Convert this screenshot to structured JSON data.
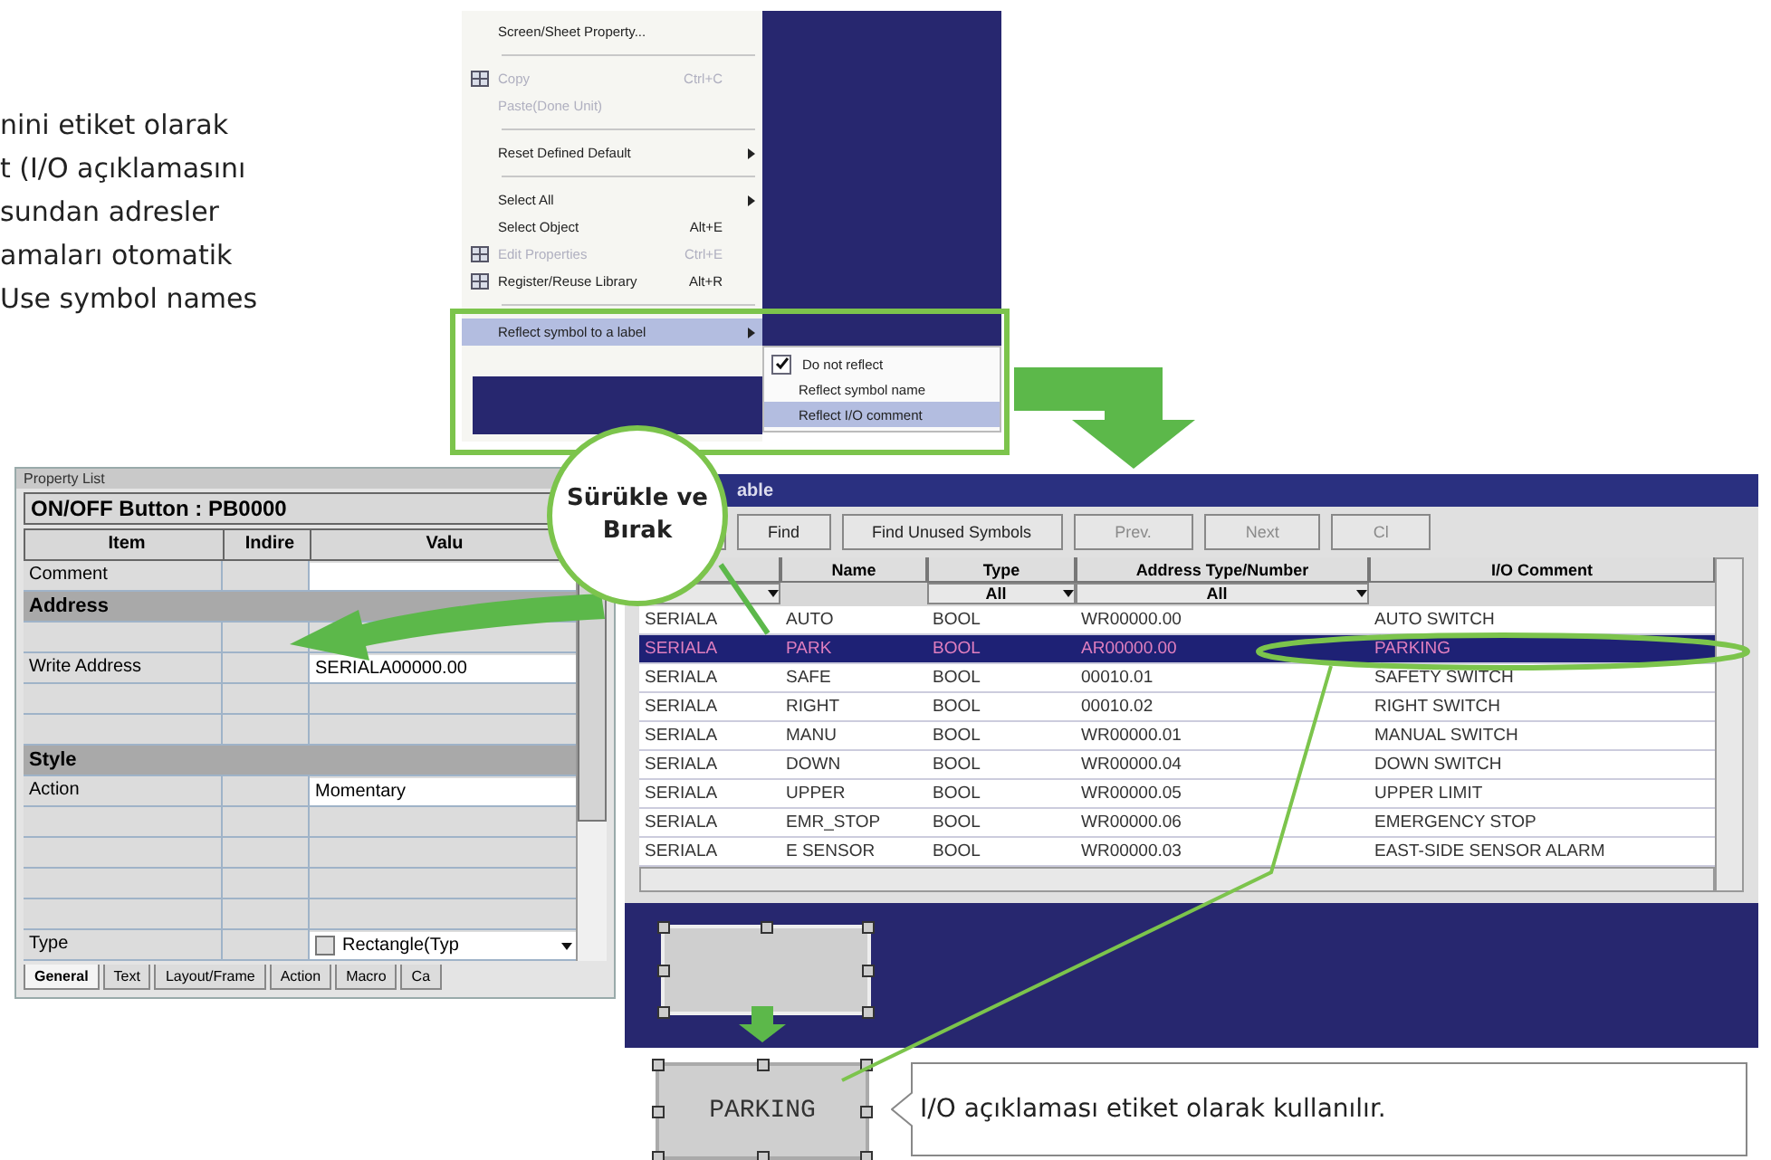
{
  "intro_text": {
    "lines": [
      "nini etiket olarak",
      "t (I/O açıklamasını",
      "sundan adresler",
      "amaları otomatik",
      "Use symbol names"
    ]
  },
  "context_menu": {
    "items": [
      {
        "kind": "item",
        "label": "Screen/Sheet Property...",
        "disabled": false,
        "selected": false,
        "has_submenu": false,
        "has_icon": false
      },
      {
        "kind": "separator"
      },
      {
        "kind": "item",
        "label": "Copy",
        "shortcut": "Ctrl+C",
        "disabled": true,
        "selected": false,
        "has_submenu": false,
        "has_icon": true
      },
      {
        "kind": "item",
        "label": "Paste(Done Unit)",
        "disabled": true,
        "selected": false,
        "has_submenu": false,
        "has_icon": false
      },
      {
        "kind": "separator"
      },
      {
        "kind": "item",
        "label": "Reset Defined Default",
        "disabled": false,
        "selected": false,
        "has_submenu": true,
        "has_icon": false
      },
      {
        "kind": "separator"
      },
      {
        "kind": "item",
        "label": "Select All",
        "disabled": false,
        "selected": false,
        "has_submenu": true,
        "has_icon": false
      },
      {
        "kind": "item",
        "label": "Select Object",
        "shortcut": "Alt+E",
        "disabled": false,
        "selected": false,
        "has_submenu": false,
        "has_icon": false
      },
      {
        "kind": "item",
        "label": "Edit Properties",
        "shortcut": "Ctrl+E",
        "disabled": true,
        "selected": false,
        "has_submenu": false,
        "has_icon": true
      },
      {
        "kind": "item",
        "label": "Register/Reuse Library",
        "shortcut": "Alt+R",
        "disabled": false,
        "selected": false,
        "has_submenu": false,
        "has_icon": true
      },
      {
        "kind": "separator"
      },
      {
        "kind": "item",
        "label": "Reflect symbol to a label",
        "disabled": false,
        "selected": true,
        "has_submenu": true,
        "has_icon": false
      }
    ]
  },
  "submenu": {
    "items": [
      {
        "label": "Do not reflect",
        "checked": true,
        "selected": false
      },
      {
        "label": "Reflect symbol name",
        "checked": false,
        "selected": false
      },
      {
        "label": "Reflect I/O comment",
        "checked": false,
        "selected": true
      }
    ]
  },
  "drag_bubble": {
    "text": "Sürükle ve Bırak"
  },
  "property_list": {
    "title": "Property List",
    "header": "ON/OFF Button : PB0000",
    "columns": [
      "Item",
      "Indire",
      "Valu"
    ],
    "rows": [
      {
        "kind": "field",
        "item": "Comment"
      },
      {
        "kind": "group",
        "item": "Address"
      },
      {
        "kind": "row"
      },
      {
        "kind": "field",
        "item": "Write Address",
        "value": "SERIALA00000.00"
      },
      {
        "kind": "row"
      },
      {
        "kind": "row"
      },
      {
        "kind": "group",
        "item": "Style"
      },
      {
        "kind": "field",
        "item": "Action",
        "value": "Momentary"
      },
      {
        "kind": "row"
      },
      {
        "kind": "row"
      },
      {
        "kind": "row"
      },
      {
        "kind": "row"
      },
      {
        "kind": "dropdown",
        "item": "Type",
        "value": "Rectangle(Typ"
      }
    ],
    "tabs": [
      {
        "label": "General",
        "selected": true
      },
      {
        "label": "Text",
        "selected": false
      },
      {
        "label": "Layout/Frame",
        "selected": false
      },
      {
        "label": "Action",
        "selected": false
      },
      {
        "label": "Macro",
        "selected": false
      },
      {
        "label": "Ca",
        "selected": false
      }
    ]
  },
  "symbol_table": {
    "title": "able",
    "buttons": [
      {
        "label": "Find",
        "disabled": false
      },
      {
        "label": "Find Unused Symbols",
        "disabled": false
      },
      {
        "label": "Prev.",
        "disabled": true
      },
      {
        "label": "Next",
        "disabled": true
      },
      {
        "label": "Cl",
        "disabled": true
      }
    ],
    "columns": [
      "Name",
      "Type",
      "Address Type/Number",
      "I/O Comment"
    ],
    "filters": [
      {
        "kind": "dropdown"
      },
      {
        "kind": "blank"
      },
      {
        "kind": "dropdown",
        "value": "All"
      },
      {
        "kind": "dropdown",
        "value": "All"
      },
      {
        "kind": "blank"
      }
    ],
    "rows": [
      {
        "cells": [
          "SERIALA",
          "AUTO",
          "BOOL",
          "WR00000.00",
          "AUTO SWITCH"
        ],
        "selected": false
      },
      {
        "cells": [
          "SERIALA",
          "PARK",
          "BOOL",
          "AR00000.00",
          "PARKING"
        ],
        "selected": true
      },
      {
        "cells": [
          "SERIALA",
          "SAFE",
          "BOOL",
          "00010.01",
          "SAFETY SWITCH"
        ],
        "selected": false
      },
      {
        "cells": [
          "SERIALA",
          "RIGHT",
          "BOOL",
          "00010.02",
          "RIGHT SWITCH"
        ],
        "selected": false
      },
      {
        "cells": [
          "SERIALA",
          "MANU",
          "BOOL",
          "WR00000.01",
          "MANUAL SWITCH"
        ],
        "selected": false
      },
      {
        "cells": [
          "SERIALA",
          "DOWN",
          "BOOL",
          "WR00000.04",
          "DOWN SWITCH"
        ],
        "selected": false
      },
      {
        "cells": [
          "SERIALA",
          "UPPER",
          "BOOL",
          "WR00000.05",
          "UPPER LIMIT"
        ],
        "selected": false
      },
      {
        "cells": [
          "SERIALA",
          "EMR_STOP",
          "BOOL",
          "WR00000.06",
          "EMERGENCY STOP"
        ],
        "selected": false
      },
      {
        "cells": [
          "SERIALA",
          "E SENSOR",
          "BOOL",
          "WR00000.03",
          "EAST-SIDE SENSOR ALARM"
        ],
        "selected": false
      }
    ]
  },
  "label_button": {
    "text": "PARKING"
  },
  "callout": {
    "text": "I/O açıklaması etiket olarak kullanılır."
  }
}
